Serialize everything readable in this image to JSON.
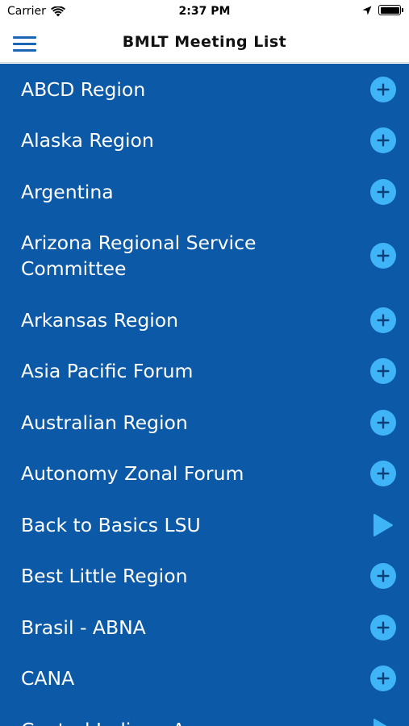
{
  "status_bar": {
    "carrier": "Carrier",
    "time": "2:37 PM",
    "icons": [
      "wifi-icon",
      "location-arrow-icon",
      "battery-icon"
    ]
  },
  "nav": {
    "title": "BMLT Meeting List",
    "menu_icon": "hamburger-menu-icon"
  },
  "colors": {
    "list_background": "#0c5aa7",
    "icon_accent": "#3fb4f7",
    "menu_accent": "#1b65b5",
    "row_text": "#ffffff"
  },
  "list": {
    "items": [
      {
        "label": "ABCD Region",
        "icon": "plus-circle-icon"
      },
      {
        "label": "Alaska Region",
        "icon": "plus-circle-icon"
      },
      {
        "label": "Argentina",
        "icon": "plus-circle-icon"
      },
      {
        "label": "Arizona Regional Service Committee",
        "icon": "plus-circle-icon"
      },
      {
        "label": "Arkansas Region",
        "icon": "plus-circle-icon"
      },
      {
        "label": "Asia Pacific Forum",
        "icon": "plus-circle-icon"
      },
      {
        "label": "Australian Region",
        "icon": "plus-circle-icon"
      },
      {
        "label": "Autonomy Zonal Forum",
        "icon": "plus-circle-icon"
      },
      {
        "label": "Back to Basics LSU",
        "icon": "play-arrow-icon"
      },
      {
        "label": "Best Little Region",
        "icon": "plus-circle-icon"
      },
      {
        "label": "Brasil - ABNA",
        "icon": "plus-circle-icon"
      },
      {
        "label": "CANA",
        "icon": "plus-circle-icon"
      },
      {
        "label": "Central Indiana Area",
        "icon": "play-arrow-icon"
      }
    ]
  }
}
